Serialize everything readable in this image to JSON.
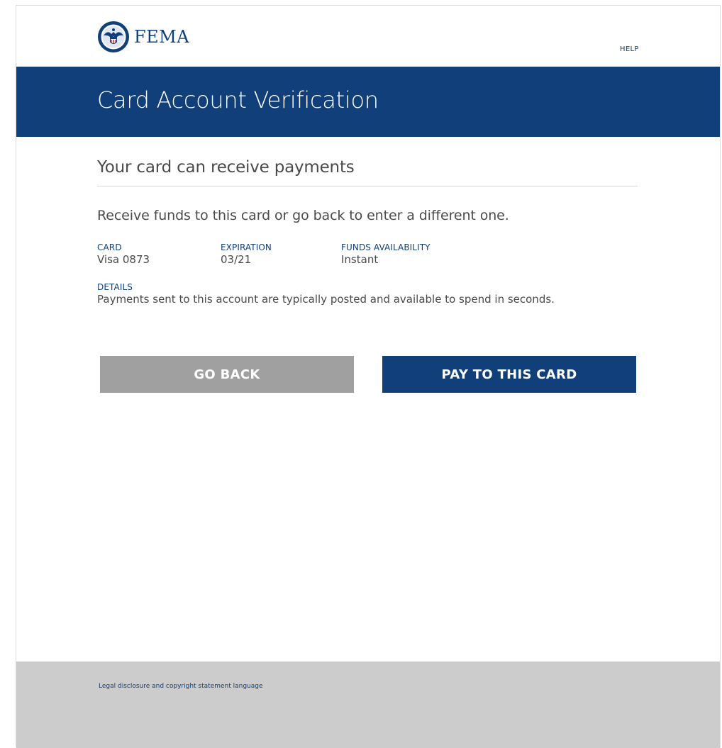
{
  "header": {
    "logo_text": "FEMA",
    "help_label": "HELP"
  },
  "banner": {
    "title": "Card Account Verification"
  },
  "main": {
    "section_title": "Your card can receive payments",
    "intro": "Receive funds to this card or go back to enter a different one.",
    "fields": {
      "card_label": "CARD",
      "card_value": "Visa 0873",
      "expiration_label": "EXPIRATION",
      "expiration_value": "03/21",
      "availability_label": "FUNDS AVAILABILITY",
      "availability_value": "Instant"
    },
    "details_label": "DETAILS",
    "details_value": "Payments sent to this account are typically posted and available to spend in seconds."
  },
  "buttons": {
    "back_label": "GO BACK",
    "pay_label": "PAY TO THIS CARD"
  },
  "footer": {
    "legal_text": "Legal disclosure and copyright statement language"
  },
  "colors": {
    "brand": "#113f7a",
    "back_button": "#a0a0a0",
    "footer_bg": "#cccccc"
  },
  "icons": {
    "logo": "dhs-seal-icon"
  }
}
